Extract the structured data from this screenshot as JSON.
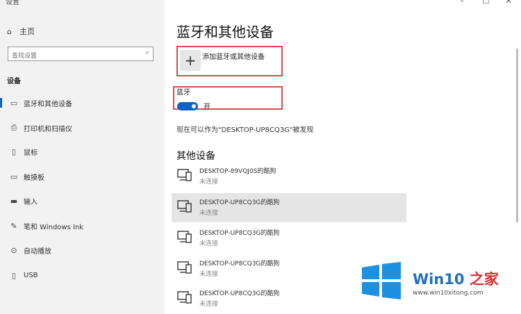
{
  "window": {
    "title": "设置",
    "minimize": "–",
    "maximize": "☐",
    "close": "✕"
  },
  "sidebar": {
    "home": "主页",
    "search_placeholder": "查找设置",
    "section": "设备",
    "items": [
      {
        "label": "蓝牙和其他设备",
        "icon": "bluetooth-device-icon"
      },
      {
        "label": "打印机和扫描仪",
        "icon": "printer-icon"
      },
      {
        "label": "鼠标",
        "icon": "mouse-icon"
      },
      {
        "label": "触摸板",
        "icon": "touchpad-icon"
      },
      {
        "label": "输入",
        "icon": "keyboard-icon"
      },
      {
        "label": "笔和 Windows Ink",
        "icon": "pen-icon"
      },
      {
        "label": "自动播放",
        "icon": "autoplay-icon"
      },
      {
        "label": "USB",
        "icon": "usb-icon"
      }
    ]
  },
  "main": {
    "title": "蓝牙和其他设备",
    "add_device": "添加蓝牙或其他设备",
    "add_symbol": "+",
    "bluetooth_label": "蓝牙",
    "bluetooth_state": "开",
    "discoverable": "现在可以作为\"DESKTOP-UP8CQ3G\"被发现",
    "other_devices_title": "其他设备",
    "devices": [
      {
        "name": "DESKTOP-89VQJ0S的酷狗",
        "status": "未连接"
      },
      {
        "name": "DESKTOP-UP8CQ3G的酷狗",
        "status": "未连接"
      },
      {
        "name": "DESKTOP-UP8CQ3G的酷狗",
        "status": "未连接"
      },
      {
        "name": "DESKTOP-UP8CQ3G的酷狗",
        "status": "未连接"
      },
      {
        "name": "DESKTOP-UP8CQ3G的酷狗",
        "status": "未连接"
      }
    ]
  },
  "watermark": {
    "brand_prefix": "Win10",
    "brand_suffix": " 之家",
    "url": "www.win10xitong.com",
    "colors": {
      "blue": "#1f6fc5",
      "red": "#d62f2f"
    }
  },
  "colors": {
    "accent": "#0a63c6",
    "highlight_box": "#d94a4a"
  }
}
